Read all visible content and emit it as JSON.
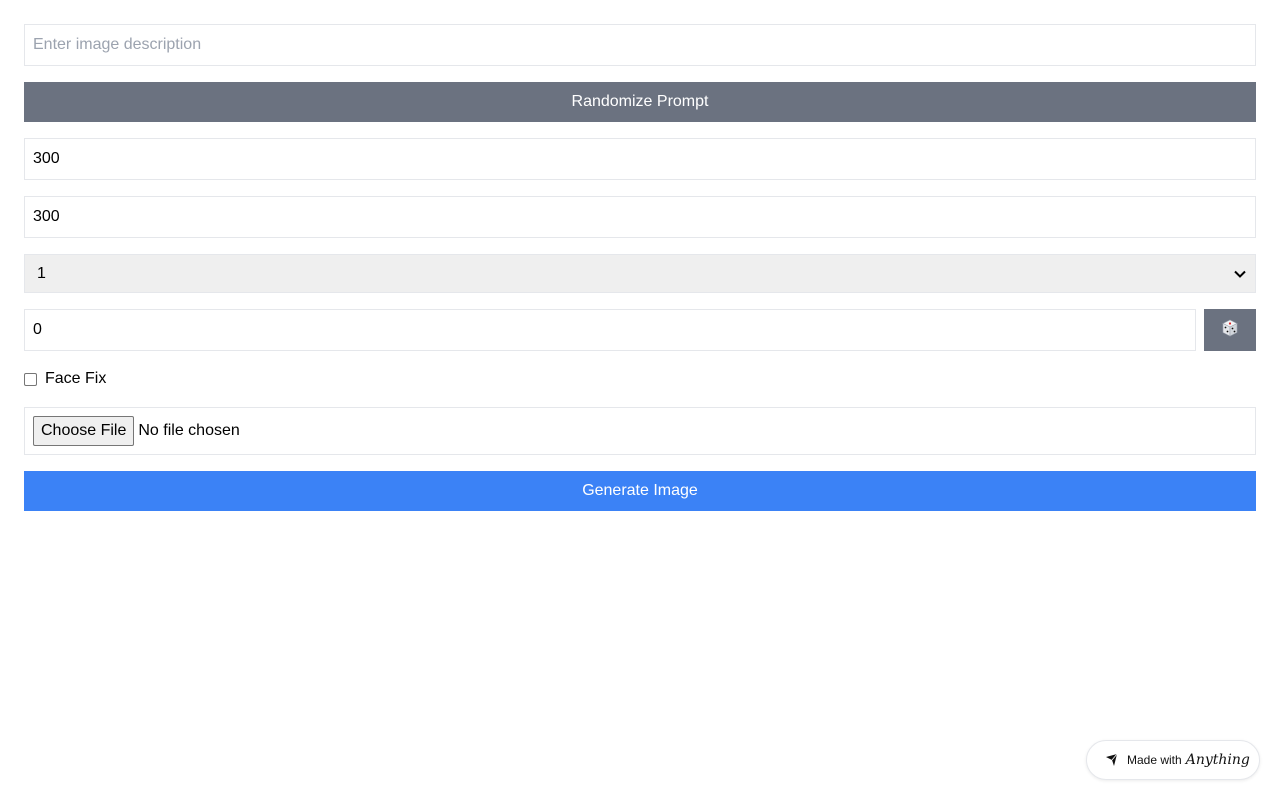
{
  "form": {
    "prompt_placeholder": "Enter image description",
    "prompt_value": "",
    "randomize_label": "Randomize Prompt",
    "width_value": "300",
    "height_value": "300",
    "count_selected": "1",
    "seed_value": "0",
    "dice_icon": "dice-icon",
    "face_fix_label": "Face Fix",
    "face_fix_checked": false,
    "file_button_label": "Choose File",
    "file_status": "No file chosen",
    "generate_label": "Generate Image"
  },
  "badge": {
    "prefix": "Made with",
    "brand": "Anything",
    "icon": "anything-logo-icon"
  },
  "colors": {
    "gray_button": "#6b7280",
    "blue_button": "#3b82f6"
  }
}
